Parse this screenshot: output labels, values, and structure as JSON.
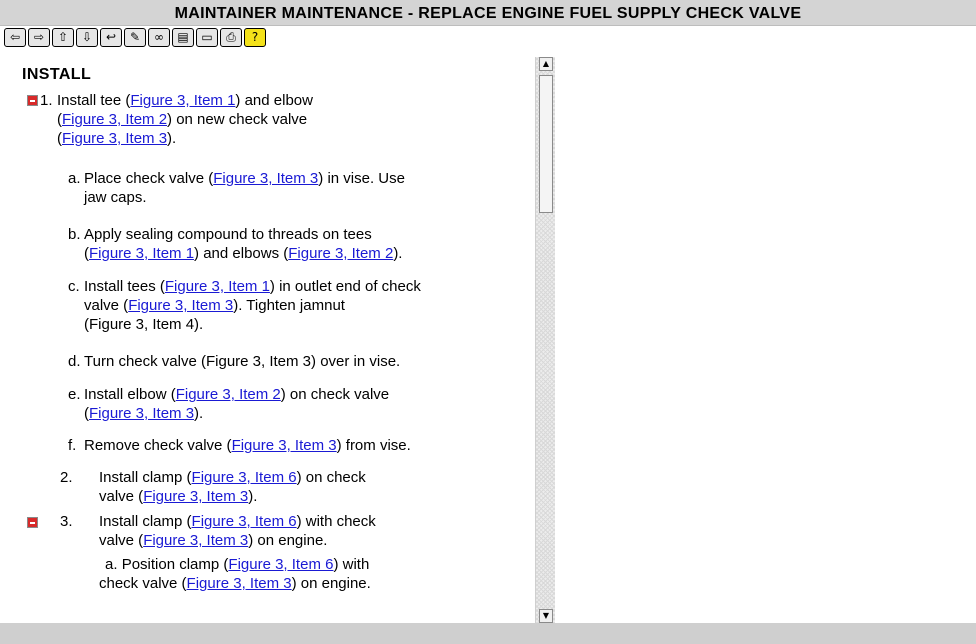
{
  "window": {
    "title": "MAINTAINER MAINTENANCE - REPLACE ENGINE  FUEL SUPPLY CHECK VALVE"
  },
  "toolbar": {
    "buttons": [
      {
        "icon": "back-arrow-icon",
        "glyph": "⇦"
      },
      {
        "icon": "forward-arrow-icon",
        "glyph": "⇨"
      },
      {
        "icon": "up-arrow-icon",
        "glyph": "⇧"
      },
      {
        "icon": "down-arrow-icon",
        "glyph": "⇩"
      },
      {
        "icon": "return-icon",
        "glyph": "↩"
      },
      {
        "icon": "highlighter-icon",
        "glyph": "✎"
      },
      {
        "icon": "binoculars-icon",
        "glyph": "∞"
      },
      {
        "icon": "screen-icon",
        "glyph": "▤"
      },
      {
        "icon": "folder-icon",
        "glyph": "▭"
      },
      {
        "icon": "print-icon",
        "glyph": "⎙"
      },
      {
        "icon": "help-icon",
        "glyph": "?"
      }
    ]
  },
  "content": {
    "heading": "INSTALL",
    "step1": {
      "num": "1.",
      "t1": "Install tee (",
      "l1": "Figure 3, Item 1",
      "t2": ") and elbow",
      "l2": "Figure 3, Item 2",
      "t3": ") on new check valve",
      "l3": "Figure 3, Item 3",
      "t4": ")."
    },
    "sub_a": {
      "num": "a.",
      "t1": "Place check valve (",
      "l1": "Figure 3, Item 3",
      "t2": ") in vise. Use",
      "t3": "jaw caps."
    },
    "sub_b": {
      "num": "b.",
      "t1": "Apply sealing compound to threads on tees",
      "l1": "Figure 3, Item 1",
      "t2": ") and elbows (",
      "l2": "Figure 3, Item 2",
      "t3": ")."
    },
    "sub_c": {
      "num": "c.",
      "t1": "Install tees (",
      "l1": "Figure 3, Item 1",
      "t2": ") in outlet end of check",
      "t3": "valve (",
      "l2": "Figure 3, Item 3",
      "t4": "). Tighten jamnut",
      "t5": "(Figure 3, Item 4)."
    },
    "sub_d": {
      "num": "d.",
      "text": "Turn check valve (Figure 3, Item 3) over in vise."
    },
    "sub_e": {
      "num": "e.",
      "t1": "Install elbow (",
      "l1": "Figure 3, Item 2",
      "t2": ") on check valve",
      "l2": "Figure 3, Item 3",
      "t3": ")."
    },
    "sub_f": {
      "num": "f.",
      "t1": "Remove check valve (",
      "l1": "Figure 3, Item 3",
      "t2": ") from vise."
    },
    "step2": {
      "num": "2.",
      "t1": "Install clamp (",
      "l1": "Figure 3, Item 6",
      "t2": ") on check",
      "t3": "valve (",
      "l2": "Figure 3, Item 3",
      "t4": ")."
    },
    "step3": {
      "num": "3.",
      "t1": "Install clamp (",
      "l1": "Figure 3, Item 6",
      "t2": ") with check",
      "t3": "valve (",
      "l2": "Figure 3, Item 3",
      "t4": ") on engine."
    },
    "step3a": {
      "num": "a.",
      "t1": "Position clamp (",
      "l1": "Figure 3, Item 6",
      "t2": ") with",
      "t3": "check valve (",
      "l2": "Figure 3, Item 3",
      "t4": ") on engine."
    }
  }
}
